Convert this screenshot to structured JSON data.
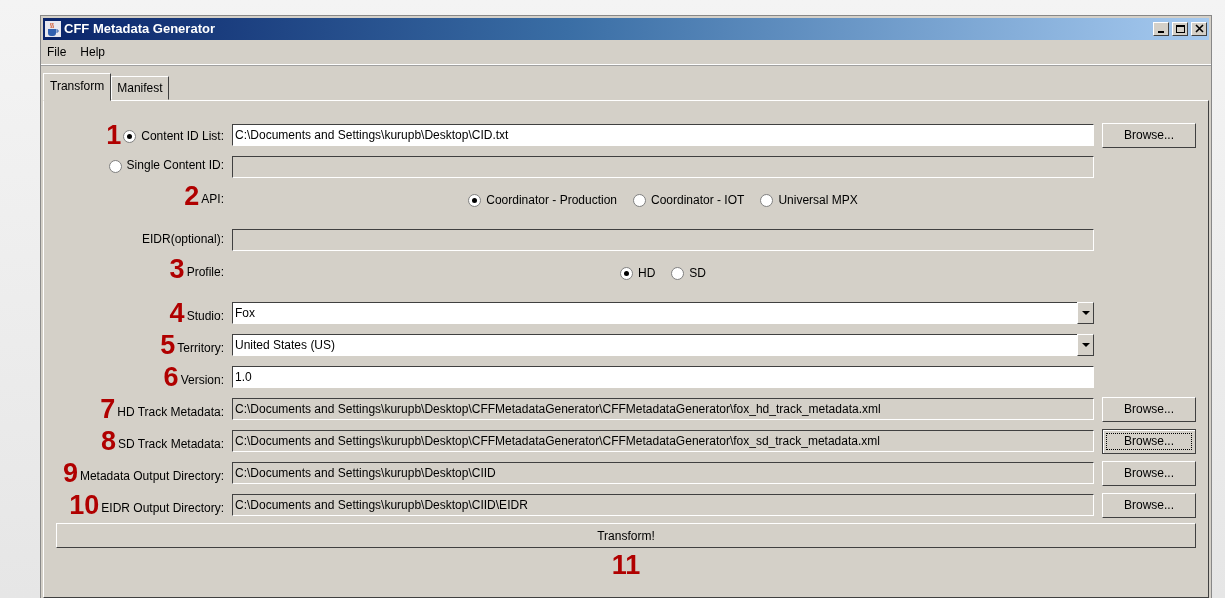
{
  "window": {
    "title": "CFF Metadata Generator"
  },
  "menu": [
    {
      "label": "File"
    },
    {
      "label": "Help"
    }
  ],
  "tabs": [
    {
      "label": "Transform",
      "selected": true
    },
    {
      "label": "Manifest",
      "selected": false
    }
  ],
  "rows": [
    {
      "kind": "radio-field",
      "marker": "1",
      "label": "Content ID List:",
      "selected": true,
      "value": "C:\\Documents and Settings\\kurupb\\Desktop\\CID.txt",
      "disabled": false,
      "button": "Browse..."
    },
    {
      "kind": "radio-field",
      "label": "Single Content ID:",
      "selected": false,
      "disabled": true
    },
    {
      "kind": "radio-group",
      "marker": "2",
      "label": "API:",
      "options": [
        {
          "label": "Coordinator - Production",
          "selected": true
        },
        {
          "label": "Coordinator - IOT",
          "selected": false
        },
        {
          "label": "Universal MPX",
          "selected": false
        }
      ]
    },
    {
      "kind": "field",
      "label": "EIDR(optional):",
      "disabled": true
    },
    {
      "kind": "radio-group",
      "marker": "3",
      "label": "Profile:",
      "options": [
        {
          "label": "HD",
          "selected": true
        },
        {
          "label": "SD",
          "selected": false
        }
      ]
    },
    {
      "kind": "dropdown",
      "marker": "4",
      "label": "Studio:",
      "value": "Fox"
    },
    {
      "kind": "dropdown",
      "marker": "5",
      "label": "Territory:",
      "value": "United States (US)"
    },
    {
      "kind": "field",
      "marker": "6",
      "label": "Version:",
      "value": "1.0",
      "disabled": false
    },
    {
      "kind": "field",
      "marker": "7",
      "label": "HD Track Metadata:",
      "value": "C:\\Documents and Settings\\kurupb\\Desktop\\CFFMetadataGenerator\\CFFMetadataGenerator\\fox_hd_track_metadata.xml",
      "disabled": true,
      "button": "Browse...",
      "focused": false
    },
    {
      "kind": "field",
      "marker": "8",
      "label": "SD Track Metadata:",
      "value": "C:\\Documents and Settings\\kurupb\\Desktop\\CFFMetadataGenerator\\CFFMetadataGenerator\\fox_sd_track_metadata.xml",
      "disabled": true,
      "button": "Browse...",
      "focused": true
    },
    {
      "kind": "field",
      "marker": "9",
      "label": "Metadata Output Directory:",
      "value": "C:\\Documents and Settings\\kurupb\\Desktop\\CIID",
      "disabled": true,
      "button": "Browse...",
      "focused": false
    },
    {
      "kind": "field",
      "marker": "10",
      "label": "EIDR Output Directory:",
      "value": "C:\\Documents and Settings\\kurupb\\Desktop\\CIID\\EIDR",
      "disabled": true,
      "button": "Browse...",
      "focused": false
    }
  ],
  "action": {
    "label": "Transform!",
    "marker": "11"
  }
}
